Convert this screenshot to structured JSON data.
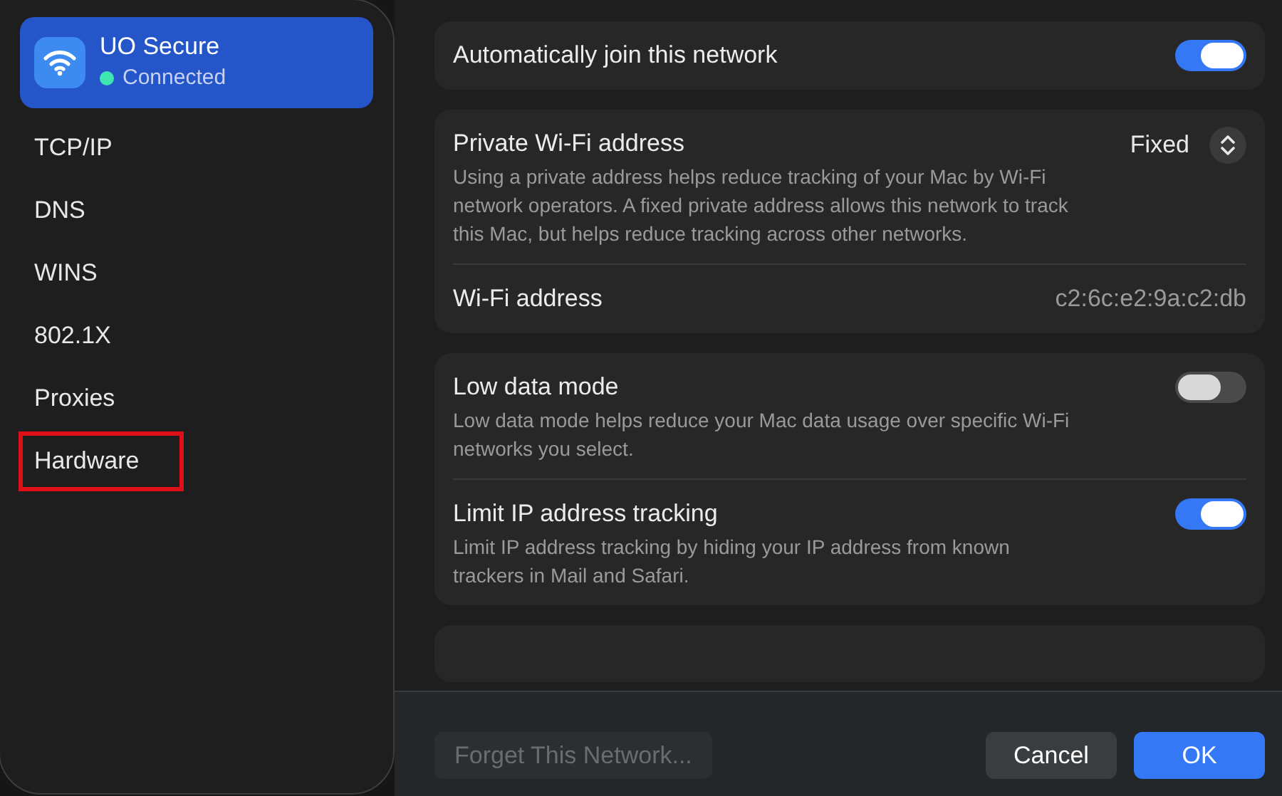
{
  "sidebar": {
    "network": {
      "name": "UO Secure",
      "status": "Connected",
      "color": "#3ee6b0",
      "selected": true
    },
    "items": [
      {
        "label": "TCP/IP",
        "highlighted": false
      },
      {
        "label": "DNS",
        "highlighted": false
      },
      {
        "label": "WINS",
        "highlighted": false
      },
      {
        "label": "802.1X",
        "highlighted": false
      },
      {
        "label": "Proxies",
        "highlighted": false
      },
      {
        "label": "Hardware",
        "highlighted": true
      }
    ]
  },
  "sections": [
    {
      "rows": [
        {
          "kind": "toggle",
          "title": "Automatically join this network",
          "on": true
        }
      ]
    },
    {
      "rows": [
        {
          "kind": "popup",
          "title": "Private Wi-Fi address",
          "value": "Fixed",
          "description": "Using a private address helps reduce tracking of your Mac by Wi-Fi network operators. A fixed private address allows this network to track this Mac, but helps reduce tracking across other networks."
        },
        {
          "kind": "info",
          "title": "Wi-Fi address",
          "value": "c2:6c:e2:9a:c2:db"
        }
      ]
    },
    {
      "rows": [
        {
          "kind": "toggle",
          "title": "Low data mode",
          "on": false,
          "description": "Low data mode helps reduce your Mac data usage over specific Wi-Fi networks you select."
        },
        {
          "kind": "toggle",
          "title": "Limit IP address tracking",
          "on": true,
          "description": "Limit IP address tracking by hiding your IP address from known trackers in Mail and Safari."
        }
      ]
    },
    {
      "kind": "partial"
    }
  ],
  "footer": {
    "forget_button": {
      "label": "Forget This Network...",
      "disabled": true
    },
    "cancel_button": "Cancel",
    "ok_button": "OK"
  }
}
